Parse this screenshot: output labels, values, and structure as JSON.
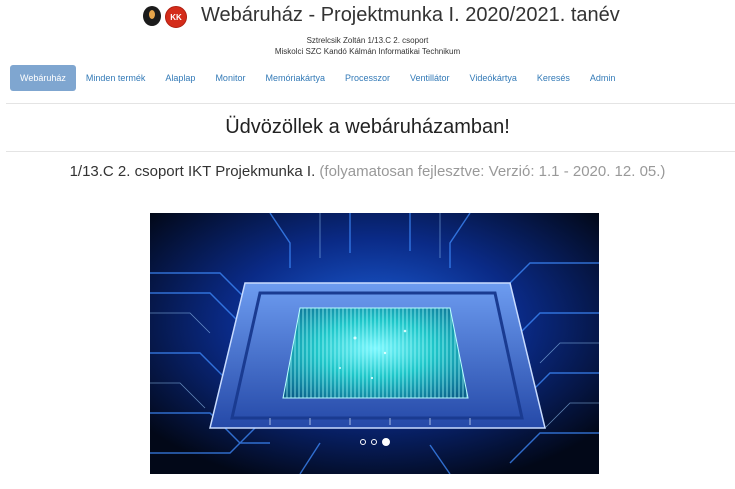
{
  "header": {
    "title": "Webáruház - Projektmunka I. 2020/2021. tanév",
    "author_line": "Sztrelcsik Zoltán 1/13.C 2. csoport",
    "school_line": "Miskolci SZC Kandó Kálmán Informatikai Technikum",
    "logo_text": "KK"
  },
  "nav": {
    "items": [
      {
        "label": "Webáruház",
        "active": true
      },
      {
        "label": "Minden termék"
      },
      {
        "label": "Alaplap"
      },
      {
        "label": "Monitor"
      },
      {
        "label": "Memóriakártya"
      },
      {
        "label": "Processzor"
      },
      {
        "label": "Ventillátor"
      },
      {
        "label": "Videókártya"
      },
      {
        "label": "Keresés"
      },
      {
        "label": "Admin"
      }
    ]
  },
  "main": {
    "welcome": "Üdvözöllek a webáruházamban!",
    "project_title": "1/13.C 2. csoport IKT Projekmunka I.",
    "project_note": "(folyamatosan fejlesztve: Verzió: 1.1 - 2020. 12. 05.)"
  },
  "carousel": {
    "slide_count": 3,
    "active_index": 2
  },
  "colors": {
    "nav_active_bg": "#7fa6d0",
    "link": "#337ab7",
    "muted": "#999999"
  }
}
